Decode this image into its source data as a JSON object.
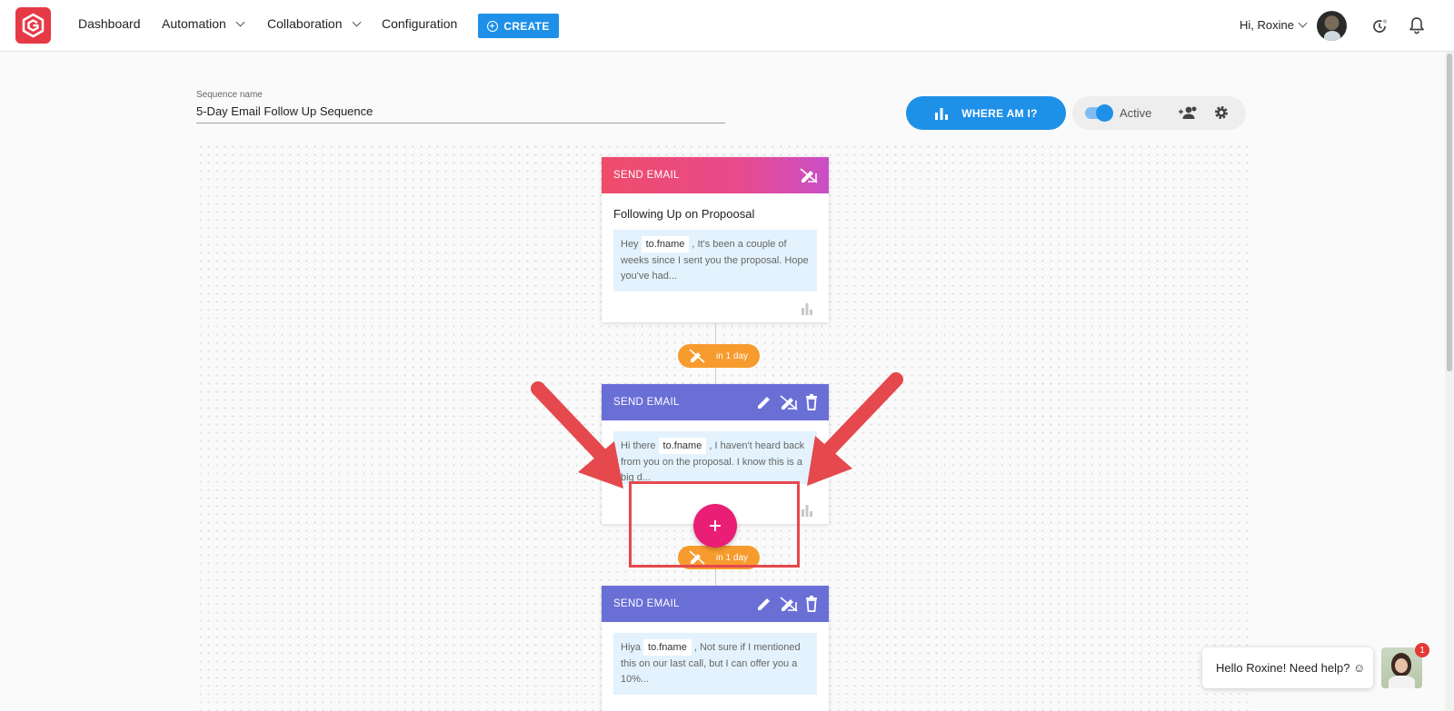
{
  "nav": {
    "items": [
      {
        "label": "Dashboard",
        "dropdown": false
      },
      {
        "label": "Automation",
        "dropdown": true
      },
      {
        "label": "Collaboration",
        "dropdown": true
      },
      {
        "label": "Configuration",
        "dropdown": false
      }
    ],
    "create_label": "CREATE",
    "greeting": "Hi, Roxine"
  },
  "sequence": {
    "name_label": "Sequence name",
    "name_value": "5-Day Email Follow Up Sequence",
    "where_label": "WHERE AM I?",
    "active_label": "Active",
    "active": true
  },
  "steps": [
    {
      "head": "SEND EMAIL",
      "title": "Following Up on Propoosal",
      "pre": "Hey",
      "token": "to.fname",
      "post": ", It's been a couple of weeks since I sent you the proposal. Hope you've had..."
    },
    {
      "head": "SEND EMAIL",
      "pre": "Hi there",
      "token": "to.fname",
      "post": ", I haven't heard back from you on the proposal. I know this is a big d..."
    },
    {
      "head": "SEND EMAIL",
      "pre": "Hiya",
      "token": "to.fname",
      "post": ", Not sure if I mentioned this on our last call, but I can offer you a 10%..."
    }
  ],
  "delays": [
    "in 1 day",
    "in 1 day"
  ],
  "help": {
    "message": "Hello Roxine! Need help? ☺",
    "badge": "1"
  },
  "colors": {
    "primary": "#1e90e8",
    "accent_pink": "#e91e74",
    "delay_orange": "#f79b2e",
    "head_blue": "#6a6fd6",
    "annotation_red": "#e5484d"
  }
}
